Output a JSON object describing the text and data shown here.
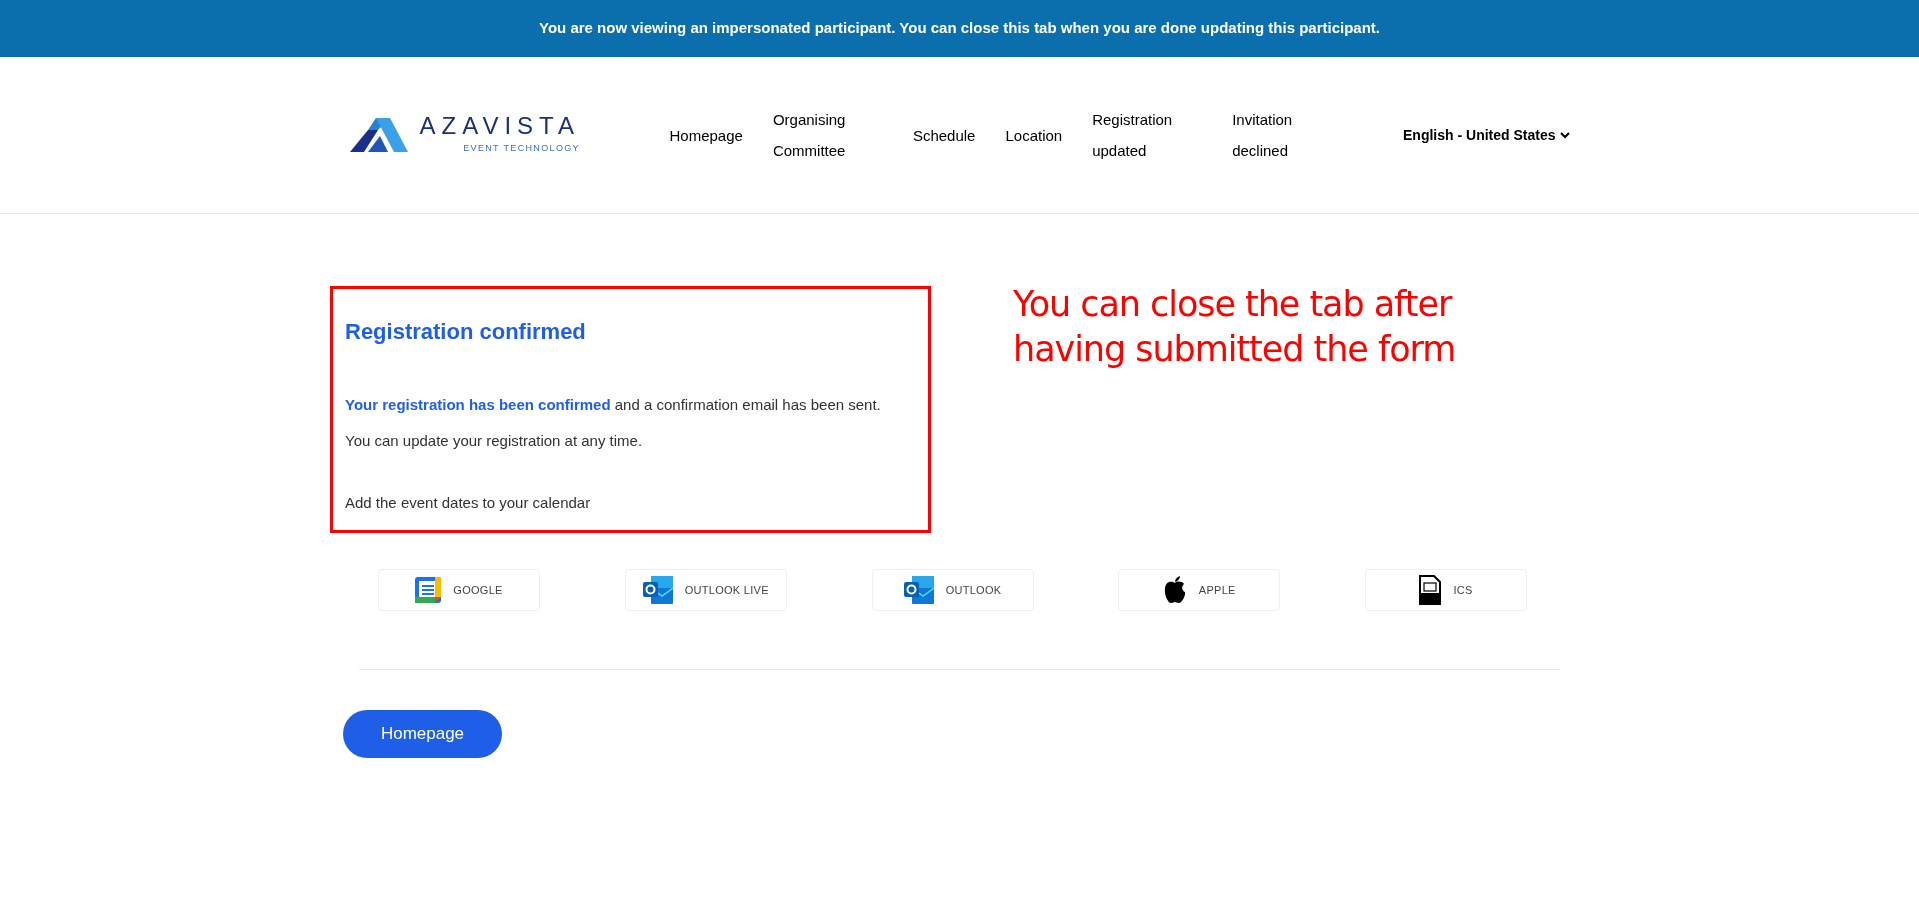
{
  "banner": {
    "text": "You are now viewing an impersonated participant. You can close this tab when you are done updating this participant."
  },
  "header": {
    "logo": {
      "name": "AZAVISTA",
      "tagline": "EVENT TECHNOLOGY"
    },
    "nav": [
      {
        "label": "Homepage"
      },
      {
        "label": "Organising Committee"
      },
      {
        "label": "Schedule"
      },
      {
        "label": "Location"
      },
      {
        "label": "Registration updated"
      },
      {
        "label": "Invitation declined"
      }
    ],
    "language": "English - United States"
  },
  "confirmation": {
    "title": "Registration confirmed",
    "message": "**Your registration has been confirmed** and a confirmation email has been sent.",
    "note": "You can update your registration at any time.",
    "calendar_prompt": "Add the event dates to your calendar"
  },
  "annotation": "You can close the tab after having submitted the form",
  "calendar_buttons": [
    {
      "kind": "google",
      "label": "GOOGLE"
    },
    {
      "kind": "outlook",
      "label": "OUTLOOK LIVE"
    },
    {
      "kind": "outlook",
      "label": "OUTLOOK"
    },
    {
      "kind": "apple",
      "label": "APPLE"
    },
    {
      "kind": "ics",
      "label": "ICS"
    }
  ],
  "homepage_button": "Homepage"
}
